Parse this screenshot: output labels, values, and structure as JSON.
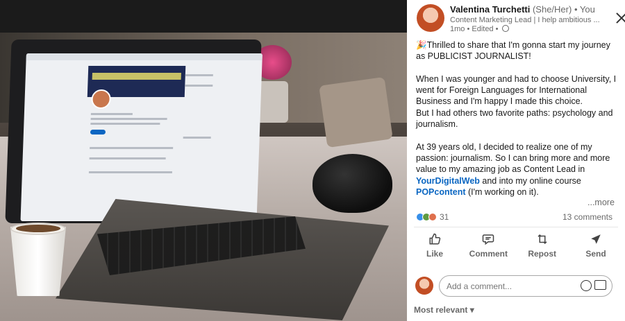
{
  "post": {
    "author_name": "Valentina Turchetti",
    "pronouns": "(She/Her)",
    "relation": "• You",
    "headline": "Content Marketing Lead | I help ambitious ...",
    "meta": "1mo • Edited •",
    "body": {
      "p1": "🎉Thrilled to share that I'm gonna start my journey as PUBLICIST JOURNALIST!",
      "p2": "When I was younger and had to choose University, I went for Foreign Languages for International Business and I'm happy I made this choice.",
      "p3": "But I had others two favorite paths: psychology and journalism.",
      "p4a": "At 39 years old, I decided to realize one of my passion: journalism. So I can bring more and more value to my amazing job as Content Lead in ",
      "link1": "YourDigitalWeb",
      "p4b": " and into my online course ",
      "link2": "POPcontent",
      "p4c": " (I'm working on it)."
    },
    "more_label": "...more",
    "reaction_count": "31",
    "comments_count": "13 comments",
    "actions": {
      "like": "Like",
      "comment": "Comment",
      "repost": "Repost",
      "send": "Send"
    },
    "comment_placeholder": "Add a comment...",
    "sort_label": "Most relevant ▾"
  },
  "colors": {
    "link": "#0a66c2",
    "like_reaction": "#378fe9",
    "celebrate_reaction": "#5f9b41",
    "love_reaction": "#df704d"
  },
  "icons": [
    "close-icon",
    "globe-icon",
    "like-icon",
    "comment-icon",
    "repost-icon",
    "send-icon",
    "emoji-icon",
    "image-icon"
  ]
}
